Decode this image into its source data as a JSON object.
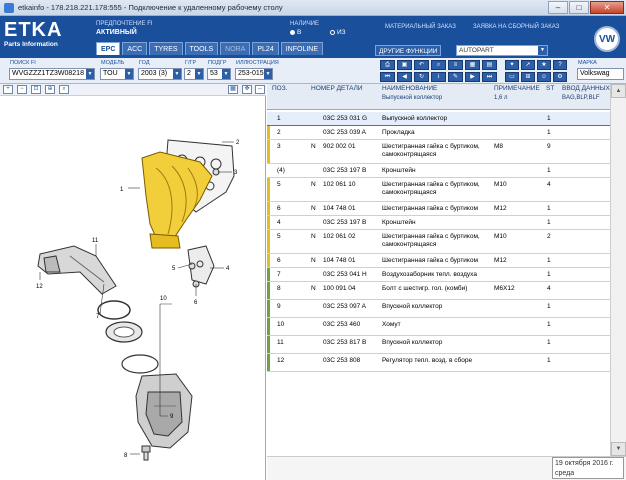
{
  "window": {
    "title": "etkainfo - 178.218.221.178:555 - Подключение к удаленному рабочему столу"
  },
  "logo": {
    "name": "ETKA",
    "subtitle": "Parts Information"
  },
  "header": {
    "preference_label": "ПРЕДПОЧТЕНИЕ FI",
    "preference_value": "АКТИВНЫЙ",
    "availability_label": "НАЛИЧИЕ",
    "radio_in": "В",
    "radio_from": "ИЗ",
    "material_order": "МАТЕРИАЛЬНЫЙ ЗАКАЗ",
    "collective_order": "ЗАЯВКА НА СБОРНЫЙ ЗАКАЗ",
    "other_functions": "ДРУГИЕ ФУНКЦИИ",
    "function_value": "AUTOPART",
    "brand_badge": "VW"
  },
  "tabs": [
    "EPC",
    "ACC",
    "TYRES",
    "TOOLS",
    "NORA",
    "PL24",
    "INFOLINE"
  ],
  "filters": {
    "search_label": "ПОИСК FI",
    "search_value": "WVGZZZ1TZ3W08218",
    "model_label": "МОДЕЛЬ",
    "model_value": "TOU",
    "year_label": "ГОД",
    "year_value": "2003 (3)",
    "group_label": "Г/ГР",
    "group_value": "2",
    "subgroup_label": "ПОДГР",
    "subgroup_value": "53",
    "illustration_label": "ИЛЛЮСТРАЦИЯ",
    "illustration_value": "253-015",
    "brand_label": "МАРКА",
    "brand_value": "Volkswag"
  },
  "table": {
    "headers": {
      "pos": "ПОЗ.",
      "part": "НОМЕР ДЕТАЛИ",
      "name": "НАИМЕНОВАНИЕ",
      "name_sub": "Выпускной коллектор",
      "note": "ПРИМЕЧАНИЕ",
      "note_sub": "1,6 л",
      "qty": "ST",
      "data": "ВВОД ДАННЫХ",
      "data_sub": "BAG,BLP,BLF"
    },
    "rows": [
      {
        "pos": "1",
        "mark": "",
        "part": "03C 253 031 G",
        "name": "Выпускной коллектор",
        "note": "",
        "qty": "1",
        "marker": "",
        "selected": true
      },
      {
        "pos": "2",
        "mark": "",
        "part": "03C 253 039 A",
        "name": "Прокладка",
        "note": "",
        "qty": "1",
        "marker": "yellow"
      },
      {
        "pos": "3",
        "mark": "N",
        "part": "902 002 01",
        "name": "Шестигранная гайка с буртиком, самоконтрящаяся",
        "note": "M8",
        "qty": "9",
        "marker": "yellow"
      },
      {
        "pos": "(4)",
        "mark": "",
        "part": "03C 253 197 B",
        "name": "Кронштейн",
        "note": "",
        "qty": "1",
        "marker": ""
      },
      {
        "pos": "5",
        "mark": "N",
        "part": "102 061 10",
        "name": "Шестигранная гайка с буртиком, самоконтрящаяся",
        "note": "M10",
        "qty": "4",
        "marker": "yellow"
      },
      {
        "pos": "6",
        "mark": "N",
        "part": "104 748 01",
        "name": "Шестигранная гайка с буртиком",
        "note": "M12",
        "qty": "1",
        "marker": "yellow"
      },
      {
        "pos": "4",
        "mark": "",
        "part": "03C 253 197 B",
        "name": "Кронштейн",
        "note": "",
        "qty": "1",
        "marker": "yellow"
      },
      {
        "pos": "5",
        "mark": "N",
        "part": "102 061 02",
        "name": "Шестигранная гайка с буртиком, самоконтрящаяся",
        "note": "M10",
        "qty": "2",
        "marker": "yellow"
      },
      {
        "pos": "6",
        "mark": "N",
        "part": "104 748 01",
        "name": "Шестигранная гайка с буртиком",
        "note": "M12",
        "qty": "1",
        "marker": "yellow"
      },
      {
        "pos": "7",
        "mark": "",
        "part": "03C 253 041 H",
        "name": "Воздухозаборник тепл. воздуха",
        "note": "",
        "qty": "1",
        "marker": "green"
      },
      {
        "pos": "8",
        "mark": "N",
        "part": "100 091 04",
        "name": "Болт с шестигр. гол. (комби)",
        "note": "M6X12",
        "qty": "4",
        "marker": "green"
      },
      {
        "pos": "9",
        "mark": "",
        "part": "03C 253 097 A",
        "name": "Впускной коллектор",
        "note": "",
        "qty": "1",
        "marker": "green"
      },
      {
        "pos": "10",
        "mark": "",
        "part": "03C 253 460",
        "name": "Хомут",
        "note": "",
        "qty": "1",
        "marker": "green"
      },
      {
        "pos": "11",
        "mark": "",
        "part": "03C 253 817 B",
        "name": "Впускной коллектор",
        "note": "",
        "qty": "1",
        "marker": "green"
      },
      {
        "pos": "12",
        "mark": "",
        "part": "03C 253 808",
        "name": "Регулятор тепл. возд. в сборе",
        "note": "",
        "qty": "1",
        "marker": "green"
      }
    ]
  },
  "diagram": {
    "callouts": [
      "1",
      "2",
      "3",
      "4",
      "5",
      "6",
      "7",
      "8",
      "9",
      "10",
      "11",
      "12"
    ]
  },
  "tooltip": {
    "date": "19 октября 2016 г.",
    "day": "среда"
  },
  "colors": {
    "header_blue": "#1a4f9c",
    "part_yellow": "#f2cf3a",
    "marker_yellow": "#e0c020",
    "marker_green": "#6fa14a"
  }
}
